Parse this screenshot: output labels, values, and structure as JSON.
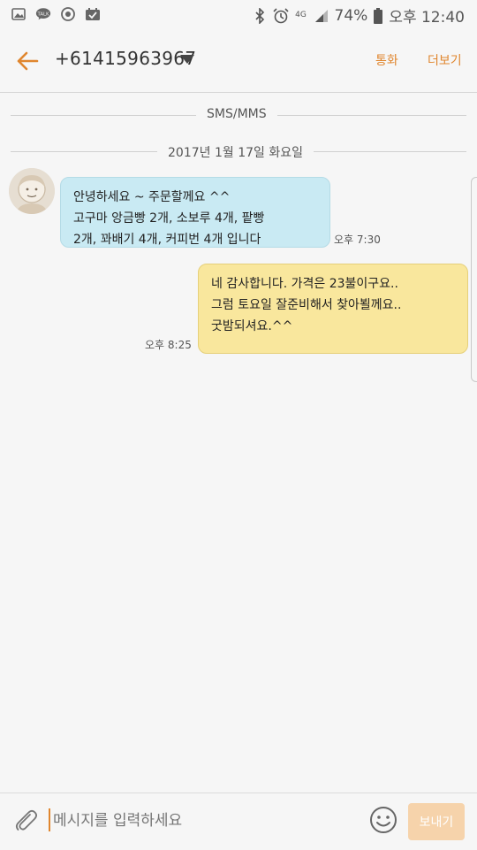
{
  "status_bar": {
    "left_icons": [
      "gallery-icon",
      "talk-icon",
      "sync-icon",
      "calendar-check-icon"
    ],
    "right_icons": [
      "bluetooth-icon",
      "alarm-icon",
      "lte-icon",
      "signal-icon",
      "battery-icon"
    ],
    "network_label": "4G",
    "battery": "74%",
    "time": "오후 12:40"
  },
  "header": {
    "contact": "+61415963967",
    "call_label": "통화",
    "more_label": "더보기",
    "accent_color": "#e0862e"
  },
  "thread": {
    "channel_label": "SMS/MMS",
    "date_label": "2017년 1월 17일 화요일",
    "messages": [
      {
        "direction": "incoming",
        "lines": [
          "안녕하세요 ~ 주문할께요 ^^",
          "고구마 앙금빵 2개, 소보루 4개, 팥빵",
          "2개, 꽈배기 4개, 커피번 4개 입니다"
        ],
        "time": "오후 7:30",
        "bubble_color": "#c9eaf3"
      },
      {
        "direction": "outgoing",
        "lines": [
          "네 감사합니다. 가격은 23불이구요..",
          "그럼 토요일 잘준비해서 찾아뵐께요..",
          "굿밤되셔요.^^"
        ],
        "time": "오후 8:25",
        "bubble_color": "#f9e79d"
      }
    ]
  },
  "composer": {
    "placeholder": "메시지를 입력하세요",
    "send_label": "보내기"
  }
}
